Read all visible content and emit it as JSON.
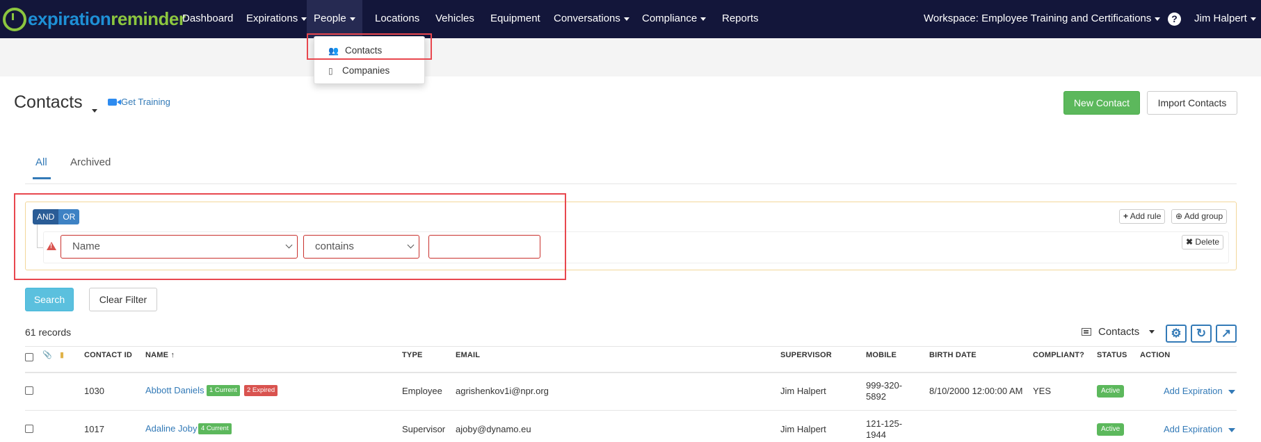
{
  "nav": {
    "logo_part1": "expiration",
    "logo_part2": "reminder",
    "items": [
      {
        "label": "Dashboard",
        "dropdown": false
      },
      {
        "label": "Expirations",
        "dropdown": true
      },
      {
        "label": "People",
        "dropdown": true,
        "active": true
      },
      {
        "label": "Locations",
        "dropdown": false
      },
      {
        "label": "Vehicles",
        "dropdown": false
      },
      {
        "label": "Equipment",
        "dropdown": false
      },
      {
        "label": "Conversations",
        "dropdown": true
      },
      {
        "label": "Compliance",
        "dropdown": true
      },
      {
        "label": "Reports",
        "dropdown": false
      }
    ],
    "workspace": "Workspace: Employee Training and Certifications",
    "user": "Jim Halpert"
  },
  "people_menu": {
    "items": [
      {
        "label": "Contacts",
        "icon": "users-icon"
      },
      {
        "label": "Companies",
        "icon": "building-icon"
      }
    ]
  },
  "page": {
    "title": "Contacts",
    "training_link": "Get Training",
    "new_button": "New Contact",
    "import_button": "Import Contacts"
  },
  "tabs": [
    {
      "label": "All",
      "active": true
    },
    {
      "label": "Archived",
      "active": false
    }
  ],
  "filter": {
    "and_label": "AND",
    "or_label": "OR",
    "add_rule": "Add rule",
    "add_group": "Add group",
    "delete": "Delete",
    "field_value": "Name",
    "operator_value": "contains",
    "value": "",
    "search_button": "Search",
    "clear_button": "Clear Filter"
  },
  "table": {
    "records_label": "61 records",
    "view_label": "Contacts",
    "columns": [
      "CONTACT ID",
      "NAME ↑",
      "TYPE",
      "EMAIL",
      "SUPERVISOR",
      "MOBILE",
      "BIRTH DATE",
      "COMPLIANT?",
      "STATUS",
      "ACTION"
    ],
    "rows": [
      {
        "contact_id": "1030",
        "name": "Abbott Daniels",
        "badge_current": "1 Current",
        "badge_expired": "2 Expired",
        "type": "Employee",
        "email": "agrishenkov1i@npr.org",
        "supervisor": "Jim Halpert",
        "mobile_line1": "999-320-",
        "mobile_line2": "5892",
        "birth_date": "8/10/2000 12:00:00 AM",
        "compliant": "YES",
        "status": "Active",
        "action": "Add Expiration"
      },
      {
        "contact_id": "1017",
        "name": "Adaline Joby",
        "badge_current": "4 Current",
        "type": "Supervisor",
        "email": "ajoby@dynamo.eu",
        "supervisor": "Jim Halpert",
        "mobile_line1": "121-125-",
        "mobile_line2": "1944",
        "birth_date": "",
        "compliant": "",
        "status": "Active",
        "action": "Add Expiration"
      }
    ]
  },
  "colors": {
    "nav_bg": "#13163a",
    "brand_blue": "#1e90d6",
    "brand_green": "#8cc63f",
    "success": "#5cb85c",
    "danger": "#d9534f",
    "link": "#337ab7",
    "highlight": "#e8474e"
  }
}
